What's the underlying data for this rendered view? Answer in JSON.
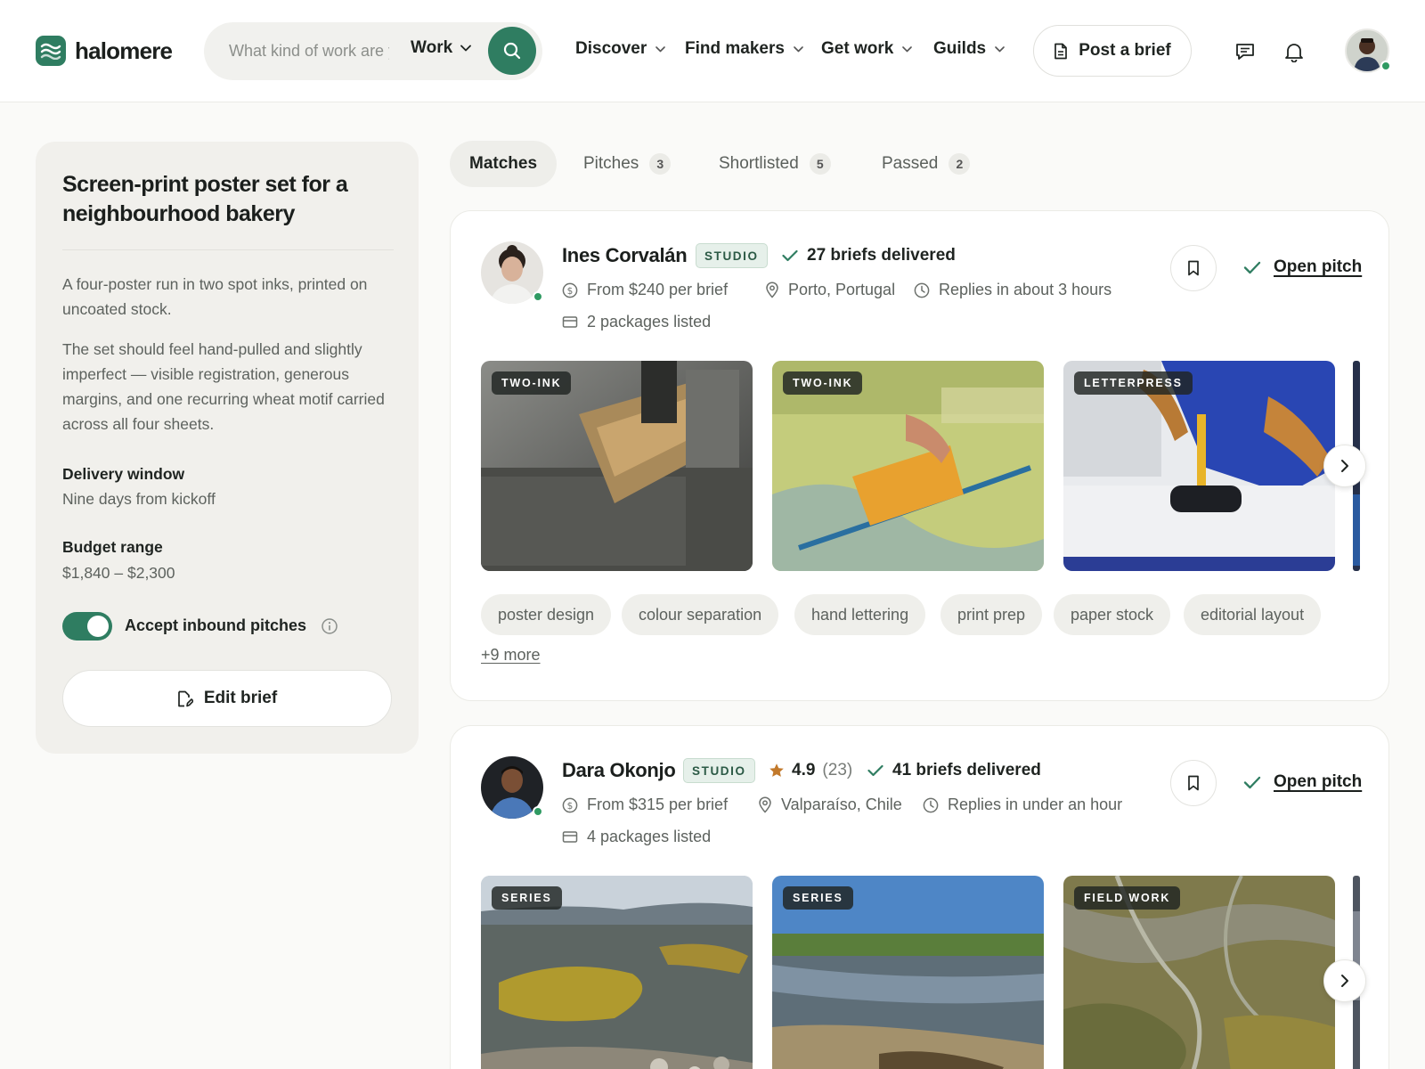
{
  "app": {
    "name": "halomere"
  },
  "search": {
    "placeholder": "What kind of work are you looking for?",
    "type_label": "Work"
  },
  "nav": [
    {
      "label": "Discover"
    },
    {
      "label": "Find makers"
    },
    {
      "label": "Get work"
    },
    {
      "label": "Guilds"
    }
  ],
  "header": {
    "post_brief_label": "Post a brief"
  },
  "brief": {
    "title": "Screen-print poster set for a neighbourhood bakery",
    "summary": "A four-poster run in two spot inks, printed on uncoated stock.",
    "description": "The set should feel hand-pulled and slightly imperfect — visible registration, generous margins, and one recurring wheat motif carried across all four sheets.",
    "delivery_label": "Delivery window",
    "delivery_value": "Nine days from kickoff",
    "budget_label": "Budget range",
    "budget_value": "$1,840 – $2,300",
    "accept_label": "Accept inbound pitches",
    "accept_enabled": true,
    "edit_label": "Edit brief"
  },
  "tabs": [
    {
      "label": "Matches",
      "count": ""
    },
    {
      "label": "Pitches",
      "count": "3"
    },
    {
      "label": "Shortlisted",
      "count": "5"
    },
    {
      "label": "Passed",
      "count": "2"
    }
  ],
  "makers": [
    {
      "name": "Ines Corvalán",
      "badge": "STUDIO",
      "delivered": "27 briefs delivered",
      "price": "From $240 per brief",
      "location": "Porto, Portugal",
      "response": "Replies in about 3 hours",
      "packages": "2 packages listed",
      "open_pitch": "Open pitch",
      "thumbs": [
        {
          "tag": "TWO-INK"
        },
        {
          "tag": "TWO-INK"
        },
        {
          "tag": "LETTERPRESS"
        }
      ],
      "skills": [
        "poster design",
        "colour separation",
        "hand lettering",
        "print prep",
        "paper stock",
        "editorial layout"
      ],
      "more": "+9 more"
    },
    {
      "name": "Dara Okonjo",
      "badge": "STUDIO",
      "rating": "4.9",
      "rating_count": "(23)",
      "delivered": "41 briefs delivered",
      "price": "From $315 per brief",
      "location": "Valparaíso, Chile",
      "response": "Replies in under an hour",
      "packages": "4 packages listed",
      "open_pitch": "Open pitch",
      "thumbs": [
        {
          "tag": "SERIES"
        },
        {
          "tag": "SERIES"
        },
        {
          "tag": "FIELD WORK"
        }
      ]
    }
  ],
  "colors": {
    "brand": "#2f7d61",
    "online": "#2f9a62",
    "star": "#c2792b"
  }
}
